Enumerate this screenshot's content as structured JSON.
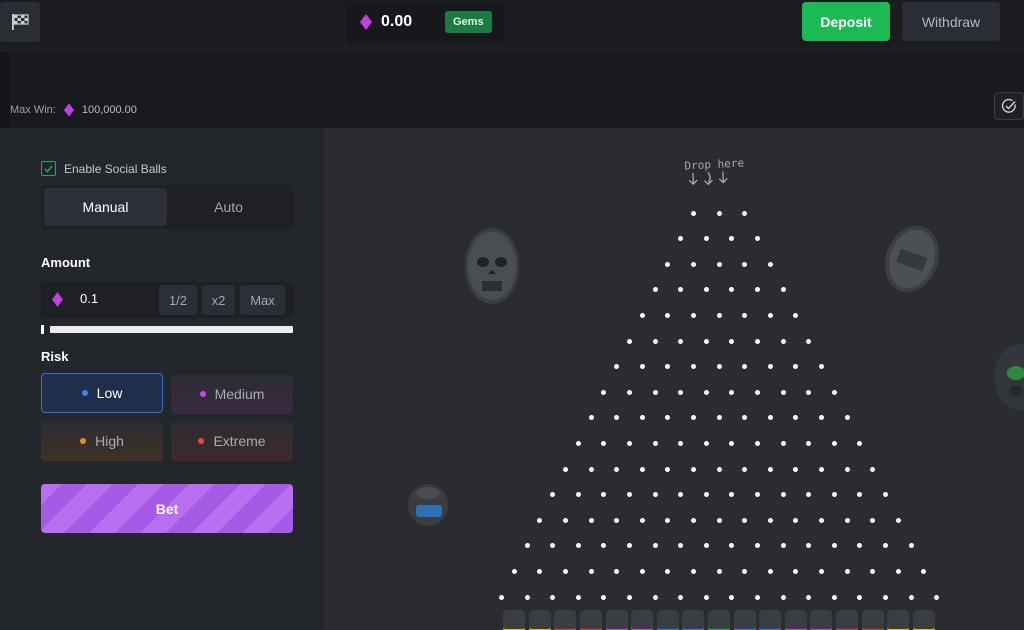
{
  "header": {
    "balance": "0.00",
    "currency": "Gems",
    "deposit_label": "Deposit",
    "withdraw_label": "Withdraw",
    "icons": [
      "checkered-flag-icon",
      "gem-icon"
    ]
  },
  "info": {
    "max_win_label": "Max Win:",
    "max_win_value": "100,000.00"
  },
  "sidebar": {
    "social_balls_label": "Enable Social Balls",
    "social_balls_checked": true,
    "tabs": [
      {
        "label": "Manual",
        "active": true
      },
      {
        "label": "Auto",
        "active": false
      }
    ],
    "amount_label": "Amount",
    "amount_value": "0.1",
    "half_label": "1/2",
    "double_label": "x2",
    "max_label": "Max",
    "risk_label": "Risk",
    "risk_options": [
      {
        "label": "Low",
        "selected": true,
        "color": "#3b82f6"
      },
      {
        "label": "Medium",
        "selected": false,
        "color": "#c04ee6"
      },
      {
        "label": "High",
        "selected": false,
        "color": "#f08a1c"
      },
      {
        "label": "Extreme",
        "selected": false,
        "color": "#e8463e"
      }
    ],
    "bet_label": "Bet"
  },
  "board": {
    "drop_hint": "Drop here",
    "rows": 16,
    "slot_colors": [
      "#e8c21c",
      "#e8463e",
      "#c04ee6",
      "#3b82f6",
      "#1db954"
    ]
  },
  "colors": {
    "accent_green": "#1db954",
    "accent_purple": "#a75ae6",
    "gem": "#c13fe0"
  }
}
